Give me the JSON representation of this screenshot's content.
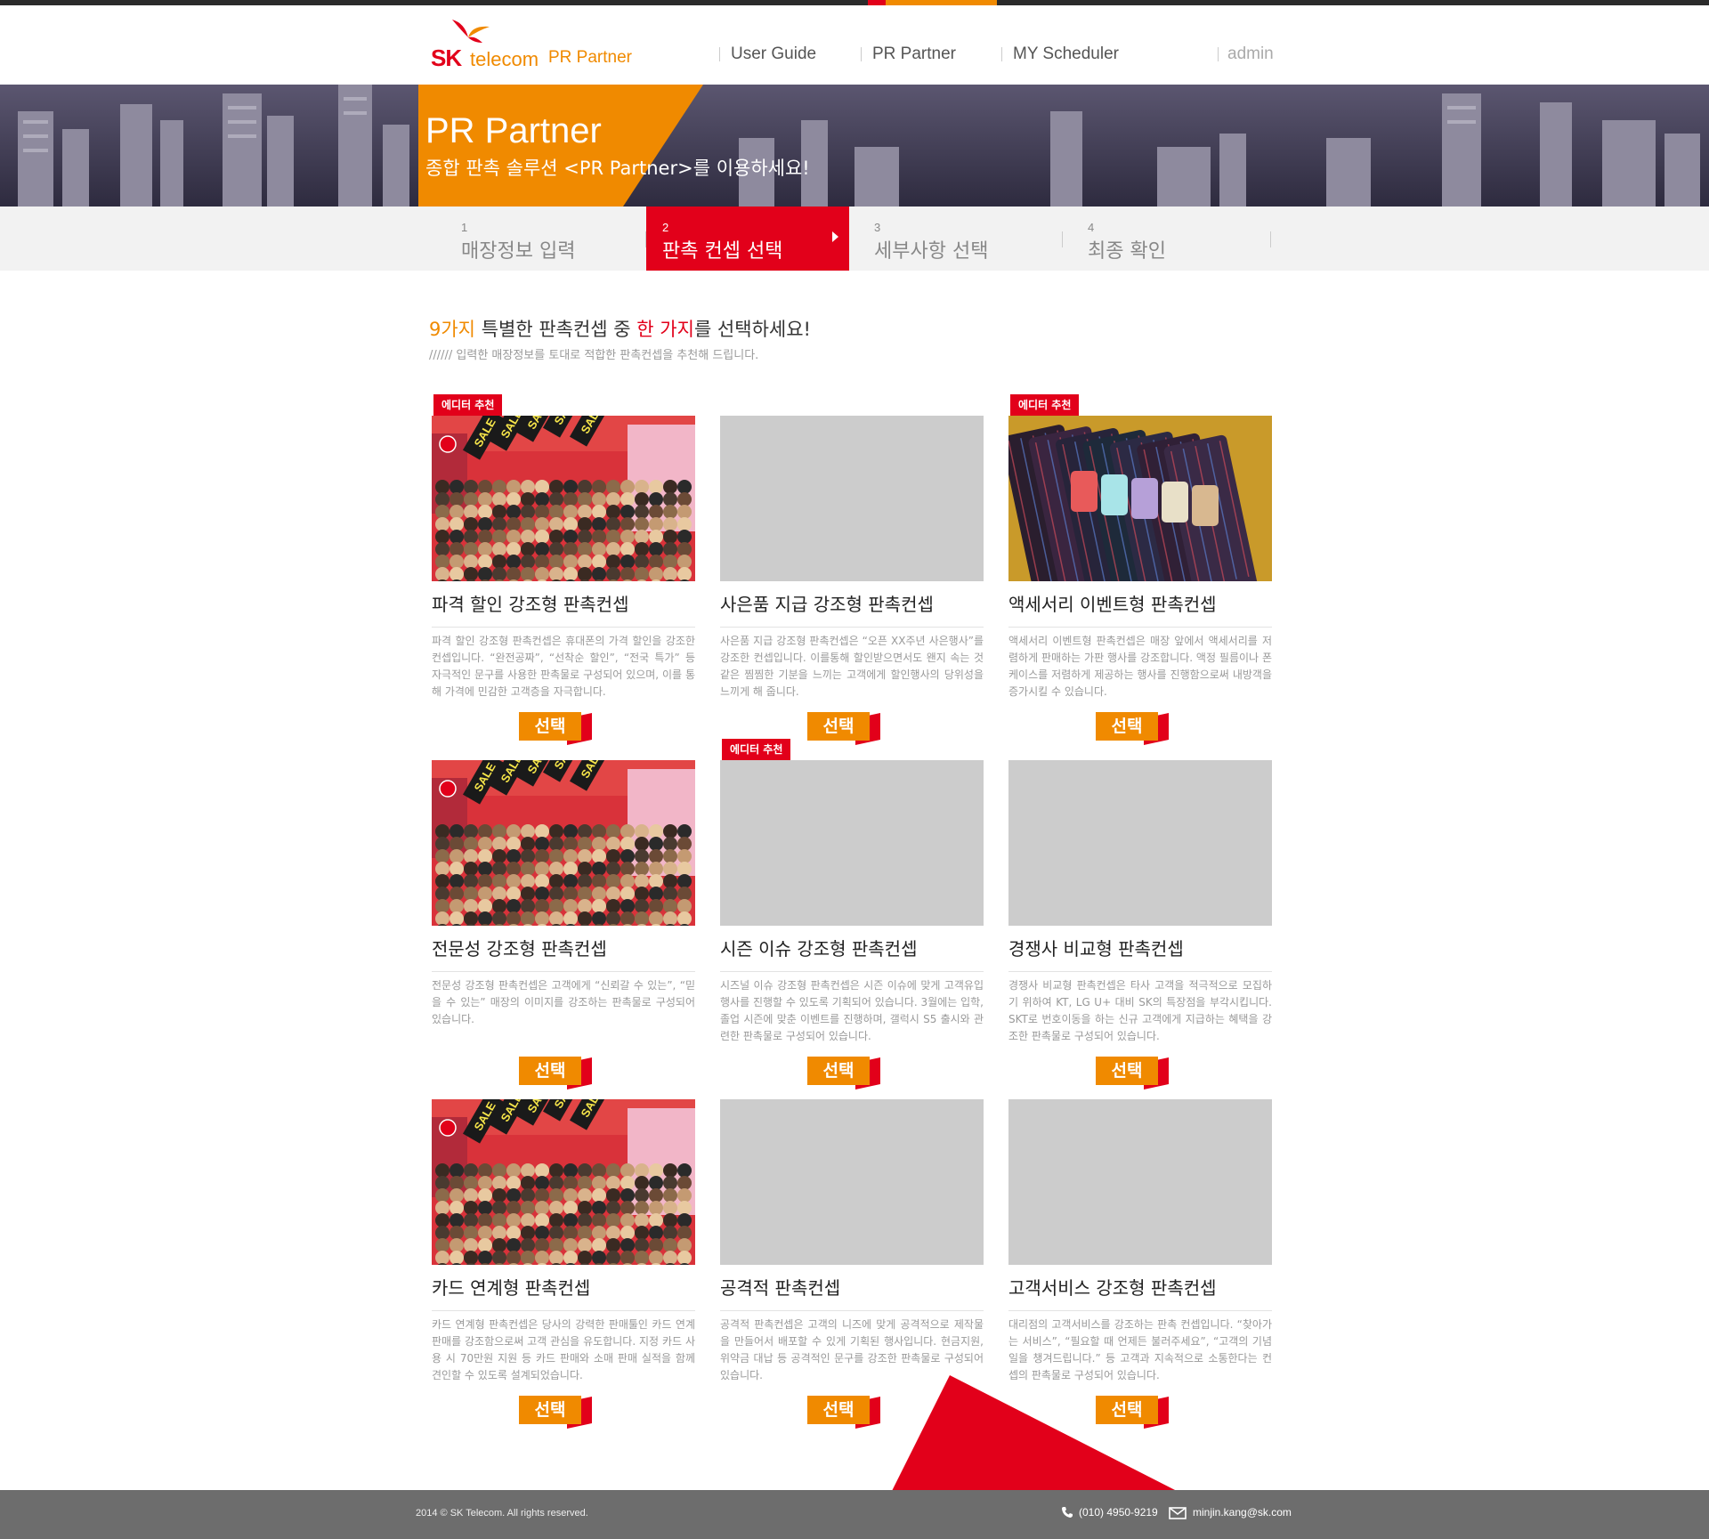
{
  "brand": {
    "logo_sk": "SK",
    "logo_telecom": "telecom",
    "logo_product": "PR Partner"
  },
  "nav": {
    "items": [
      "User Guide",
      "PR Partner",
      "MY Scheduler"
    ],
    "user": "admin"
  },
  "hero": {
    "title": "PR Partner",
    "subtitle": "종합 판촉 솔루션 <PR Partner>를 이용하세요!"
  },
  "steps": [
    {
      "num": "1",
      "label": "매장정보 입력",
      "active": false
    },
    {
      "num": "2",
      "label": "판촉 컨셉 선택",
      "active": true
    },
    {
      "num": "3",
      "label": "세부사항 선택",
      "active": false
    },
    {
      "num": "4",
      "label": "최종 확인",
      "active": false
    }
  ],
  "intro": {
    "h_part1": "9가지",
    "h_part2": " 특별한 판촉컨셉 중 ",
    "h_part3": "한",
    "h_part4": " ",
    "h_part5": "가지",
    "h_part6": "를 선택하세요!",
    "sub": "////// 입력한 매장정보를 토대로 적합한 판촉컨셉을 추천해 드립니다."
  },
  "badge_label": "에디터 추천",
  "select_label": "선택",
  "cards": [
    {
      "title": "파격 할인 강조형 판촉컨셉",
      "desc": "파격 할인 강조형 판촉컨셉은 휴대폰의 가격 할인을 강조한 컨셉입니다. “완전공짜”, “선착순 할인”, “전국 특가” 등 자극적인 문구를 사용한 판촉물로 구성되어 있으며, 이를 통해 가격에 민감한 고객층을 자극합니다.",
      "badge": true,
      "image": "sale-crowd"
    },
    {
      "title": "사은품 지급 강조형 판촉컨셉",
      "desc": "사은품 지급 강조형 판촉컨셉은 “오픈 XX주년 사은행사”를 강조한 컨셉입니다. 이를통해 할인받으면서도 왠지 속는 것 같은 찜찜한 기분을 느끼는 고객에게 할인행사의 당위성을 느끼게 해 줍니다.",
      "badge": false,
      "image": "placeholder"
    },
    {
      "title": "액세서리 이벤트형 판촉컨셉",
      "desc": "액세서리 이벤트형 판촉컨셉은 매장 앞에서 액세서리를 저렴하게 판매하는 가판 행사를 강조합니다. 액정 필름이나 폰케이스를 저렴하게 제공하는 행사를 진행함으로써 내방객을 증가시킬 수 있습니다.",
      "badge": true,
      "image": "phone-cases"
    },
    {
      "title": "전문성 강조형 판촉컨셉",
      "desc": "전문성 강조형 판촉컨셉은 고객에게 “신뢰갈 수 있는”, “믿을 수 있는” 매장의 이미지를 강조하는 판촉물로 구성되어 있습니다.",
      "badge": false,
      "image": "sale-crowd"
    },
    {
      "title": "시즌 이슈 강조형 판촉컨셉",
      "desc": "시즈널 이슈 강조형 판촉컨셉은 시즌 이슈에 맞게 고객유입 행사를 진행할 수 있도록 기획되어 있습니다. 3월에는 입학, 졸업 시즌에 맞춘 이벤트를 진행하며, 갤럭시 S5 출시와 관련한 판촉물로 구성되어 있습니다.",
      "badge": true,
      "image": "placeholder"
    },
    {
      "title": "경쟁사 비교형 판촉컨셉",
      "desc": "경쟁사 비교형 판촉컨셉은 타사 고객을 적극적으로 모집하기 위하여 KT, LG U+ 대비 SK의 특장점을 부각시킵니다. SKT로 번호이동을 하는 신규 고객에게 지급하는 혜택을 강조한 판촉물로 구성되어 있습니다.",
      "badge": false,
      "image": "placeholder"
    },
    {
      "title": "카드 연계형 판촉컨셉",
      "desc": "카드 연계형 판촉컨셉은 당사의 강력한 판매툴인 카드 연계 판매를 강조함으로써 고객 관심을 유도합니다. 지정 카드 사용 시 70만원 지원 등 카드 판매와 소매 판매 실적을 함께 견인할 수 있도록 설계되었습니다.",
      "badge": false,
      "image": "sale-crowd"
    },
    {
      "title": "공격적 판촉컨셉",
      "desc": "공격적 판촉컨셉은 고객의 니즈에 맞게 공격적으로 제작물을 만들어서 배포할 수 있게 기획된 행사입니다. 현금지원, 위약금 대납 등 공격적인 문구를 강조한 판촉물로 구성되어 있습니다.",
      "badge": false,
      "image": "placeholder"
    },
    {
      "title": "고객서비스 강조형 판촉컨셉",
      "desc": "대리점의 고객서비스를 강조하는 판촉 컨셉입니다. “찾아가는 서비스”, “필요할 때 언제든 불러주세요”, “고객의 기념일을 챙겨드립니다.” 등 고객과 지속적으로 소통한다는 컨셉의 판촉물로 구성되어 있습니다.",
      "badge": false,
      "image": "placeholder"
    }
  ],
  "footer": {
    "copyright": "2014 © SK Telecom. All rights reserved.",
    "phone": "(010) 4950-9219",
    "email": "minjin.kang@sk.com"
  },
  "colors": {
    "red": "#e2001a",
    "orange": "#f08a00",
    "footer": "#6d6d6d"
  }
}
